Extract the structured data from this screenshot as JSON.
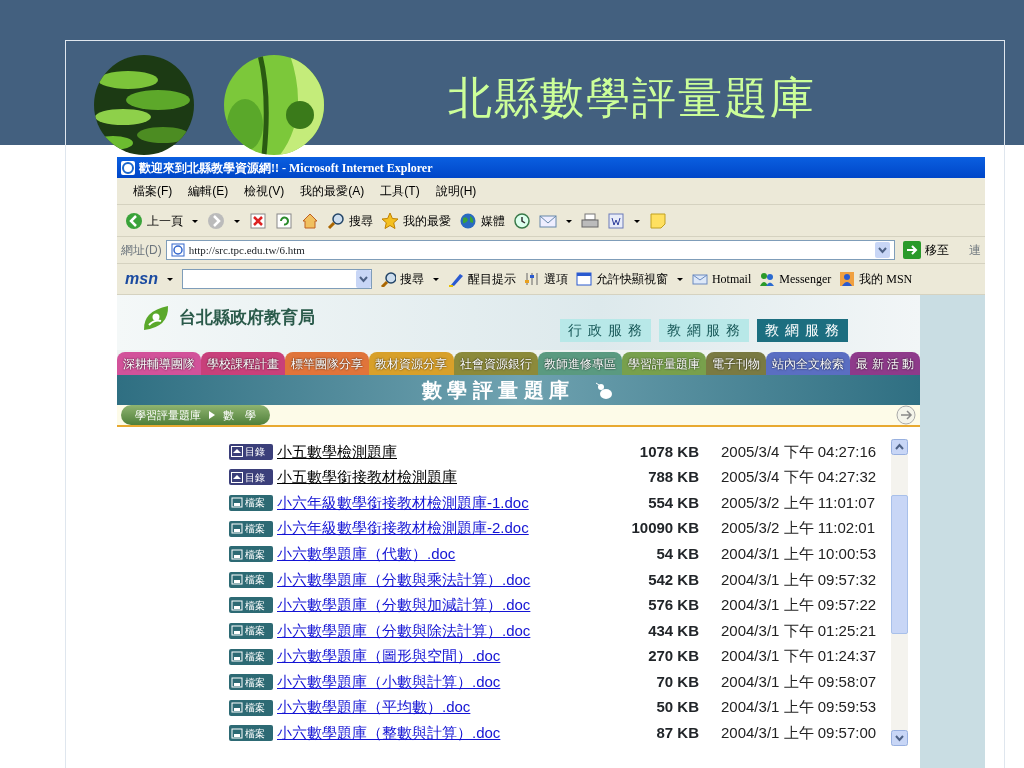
{
  "slide": {
    "title": "北縣數學評量題庫"
  },
  "browser": {
    "title": "歡迎來到北縣教學資源網!! - Microsoft Internet Explorer",
    "menu": [
      "檔案(F)",
      "編輯(E)",
      "檢視(V)",
      "我的最愛(A)",
      "工具(T)",
      "說明(H)"
    ],
    "toolbar": [
      {
        "kind": "back",
        "label": "上一頁"
      },
      {
        "kind": "forward"
      },
      {
        "kind": "stop"
      },
      {
        "kind": "refresh"
      },
      {
        "kind": "home"
      },
      {
        "kind": "search",
        "label": "搜尋"
      },
      {
        "kind": "favorites",
        "label": "我的最愛"
      },
      {
        "kind": "media",
        "label": "媒體"
      },
      {
        "kind": "history"
      },
      {
        "kind": "mail"
      },
      {
        "kind": "print"
      },
      {
        "kind": "word"
      },
      {
        "kind": "note"
      }
    ],
    "address": {
      "label": "網址(D)",
      "url": "http://src.tpc.edu.tw/6.htm",
      "go": "移至",
      "links": "連"
    },
    "msn_bar": {
      "logo": "msn",
      "search": "搜尋",
      "highlight": "醒目提示",
      "options": "選項",
      "popup": "允許快顯視窗",
      "links": [
        "Hotmail",
        "Messenger",
        "我的 MSN"
      ]
    }
  },
  "page": {
    "agency": "台北縣政府教育局",
    "services": [
      {
        "label": "行 政 服 務",
        "selected": false
      },
      {
        "label": "教 網 服 務",
        "selected": false
      },
      {
        "label": "教 網 服 務",
        "selected": true
      }
    ],
    "tabs": [
      {
        "label": "深耕輔導團隊",
        "color": "#d2529a"
      },
      {
        "label": "學校課程計畫",
        "color": "#c8407a"
      },
      {
        "label": "標竿團隊分享",
        "color": "#e0743a"
      },
      {
        "label": "教材資源分享",
        "color": "#d8a02a"
      },
      {
        "label": "社會資源銀行",
        "color": "#8c8a3a"
      },
      {
        "label": "教師進修專區",
        "color": "#5a9a80"
      },
      {
        "label": "學習評量題庫",
        "color": "#78a04c"
      },
      {
        "label": "電子刊物",
        "color": "#7a7a42"
      },
      {
        "label": "站內全文檢索",
        "color": "#5a6ec2"
      },
      {
        "label": "最 新 活 動",
        "color": "#8e3a8a"
      }
    ],
    "banner": "數 學 評 量 題 庫",
    "breadcrumb": [
      "學習評量題庫",
      "數　學"
    ],
    "files": [
      {
        "kind": "folder",
        "badge": "目錄",
        "name": "小五數學檢測題庫",
        "size": "1078 KB",
        "date": "2005/3/4 下午 04:27:16"
      },
      {
        "kind": "folder",
        "badge": "目錄",
        "name": "小五數學銜接教材檢測題庫",
        "size": "788 KB",
        "date": "2005/3/4 下午 04:27:32"
      },
      {
        "kind": "file",
        "badge": "檔案",
        "name": "小六年級數學銜接教材檢測題庫-1.doc",
        "size": "554 KB",
        "date": "2005/3/2 上午 11:01:07"
      },
      {
        "kind": "file",
        "badge": "檔案",
        "name": "小六年級數學銜接教材檢測題庫-2.doc",
        "size": "10090 KB",
        "date": "2005/3/2 上午 11:02:01"
      },
      {
        "kind": "file",
        "badge": "檔案",
        "name": "小六數學題庫（代數）.doc",
        "size": "54 KB",
        "date": "2004/3/1 上午 10:00:53"
      },
      {
        "kind": "file",
        "badge": "檔案",
        "name": "小六數學題庫（分數與乘法計算）.doc",
        "size": "542 KB",
        "date": "2004/3/1 上午 09:57:32"
      },
      {
        "kind": "file",
        "badge": "檔案",
        "name": "小六數學題庫（分數與加減計算）.doc",
        "size": "576 KB",
        "date": "2004/3/1 上午 09:57:22"
      },
      {
        "kind": "file",
        "badge": "檔案",
        "name": "小六數學題庫（分數與除法計算）.doc",
        "size": "434 KB",
        "date": "2004/3/1 下午 01:25:21"
      },
      {
        "kind": "file",
        "badge": "檔案",
        "name": "小六數學題庫（圖形與空間）.doc",
        "size": "270 KB",
        "date": "2004/3/1 下午 01:24:37"
      },
      {
        "kind": "file",
        "badge": "檔案",
        "name": "小六數學題庫（小數與計算）.doc",
        "size": "70 KB",
        "date": "2004/3/1 上午 09:58:07"
      },
      {
        "kind": "file",
        "badge": "檔案",
        "name": "小六數學題庫（平均數）.doc",
        "size": "50 KB",
        "date": "2004/3/1 上午 09:59:53"
      },
      {
        "kind": "file",
        "badge": "檔案",
        "name": "小六數學題庫（整數與計算）.doc",
        "size": "87 KB",
        "date": "2004/3/1 上午 09:57:00"
      }
    ]
  }
}
